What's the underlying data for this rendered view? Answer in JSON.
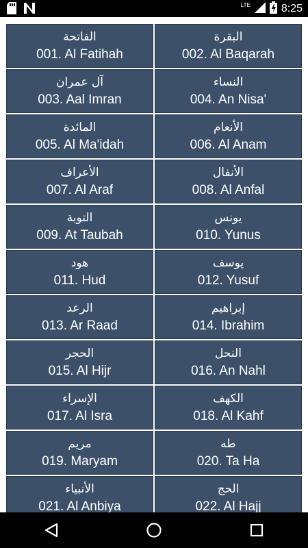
{
  "status_bar": {
    "time": "8:25",
    "network": "LTE",
    "icons": [
      "sd-card-icon",
      "notification-n-icon",
      "signal-icon",
      "battery-charging-icon"
    ]
  },
  "colors": {
    "cell_bg": "#3c5069",
    "cell_border": "#283a52",
    "status_bg": "#000000",
    "nav_bg": "#000000"
  },
  "surahs": [
    {
      "arabic": "الفاتحة",
      "english": "001. Al Fatihah"
    },
    {
      "arabic": "البقرة",
      "english": "002. Al Baqarah"
    },
    {
      "arabic": "آل عمران",
      "english": "003. Aal Imran"
    },
    {
      "arabic": "النساء",
      "english": "004. An Nisa'"
    },
    {
      "arabic": "المائدة",
      "english": "005. Al Ma'idah"
    },
    {
      "arabic": "الأنعام",
      "english": "006. Al Anam"
    },
    {
      "arabic": "الأعراف",
      "english": "007. Al Araf"
    },
    {
      "arabic": "الأنفال",
      "english": "008. Al Anfal"
    },
    {
      "arabic": "التوبة",
      "english": "009. At Taubah"
    },
    {
      "arabic": "يونس",
      "english": "010. Yunus"
    },
    {
      "arabic": "هود",
      "english": "011. Hud"
    },
    {
      "arabic": "يوسف",
      "english": "012. Yusuf"
    },
    {
      "arabic": "الرعد",
      "english": "013. Ar Raad"
    },
    {
      "arabic": "إبراهيم",
      "english": "014. Ibrahim"
    },
    {
      "arabic": "الحجر",
      "english": "015. Al Hijr"
    },
    {
      "arabic": "النحل",
      "english": "016. An Nahl"
    },
    {
      "arabic": "الإسراء",
      "english": "017. Al Isra"
    },
    {
      "arabic": "الكهف",
      "english": "018. Al Kahf"
    },
    {
      "arabic": "مريم",
      "english": "019. Maryam"
    },
    {
      "arabic": "طه",
      "english": "020. Ta Ha"
    },
    {
      "arabic": "الأنبياء",
      "english": "021. Al Anbiya"
    },
    {
      "arabic": "الحج",
      "english": "022. Al Hajj"
    }
  ],
  "nav_bar": {
    "icons": [
      "back-icon",
      "home-icon",
      "recents-icon"
    ]
  }
}
